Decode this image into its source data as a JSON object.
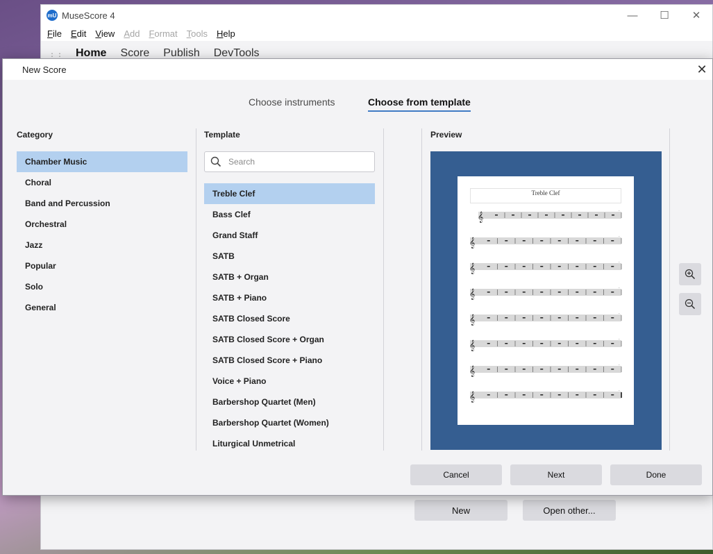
{
  "app": {
    "title": "MuseScore 4",
    "logo_text": "mU",
    "menu": [
      {
        "label": "File",
        "underline": "F",
        "rest": "ile",
        "enabled": true
      },
      {
        "label": "Edit",
        "underline": "E",
        "rest": "dit",
        "enabled": true
      },
      {
        "label": "View",
        "underline": "V",
        "rest": "iew",
        "enabled": true
      },
      {
        "label": "Add",
        "underline": "A",
        "rest": "dd",
        "enabled": false
      },
      {
        "label": "Format",
        "underline": "F",
        "rest": "ormat",
        "enabled": false
      },
      {
        "label": "Tools",
        "underline": "T",
        "rest": "ools",
        "enabled": false
      },
      {
        "label": "Help",
        "underline": "H",
        "rest": "elp",
        "enabled": true
      }
    ],
    "top_tabs": [
      "Home",
      "Score",
      "Publish",
      "DevTools"
    ],
    "home_buttons": {
      "new": "New",
      "open_other": "Open other..."
    }
  },
  "dialog": {
    "title": "New Score",
    "mode_tabs": [
      {
        "label": "Choose instruments",
        "active": false
      },
      {
        "label": "Choose from template",
        "active": true
      }
    ],
    "category_label": "Category",
    "categories": [
      {
        "label": "Chamber Music",
        "selected": true
      },
      {
        "label": "Choral",
        "selected": false
      },
      {
        "label": "Band and Percussion",
        "selected": false
      },
      {
        "label": "Orchestral",
        "selected": false
      },
      {
        "label": "Jazz",
        "selected": false
      },
      {
        "label": "Popular",
        "selected": false
      },
      {
        "label": "Solo",
        "selected": false
      },
      {
        "label": "General",
        "selected": false
      }
    ],
    "template_label": "Template",
    "search_placeholder": "Search",
    "templates": [
      {
        "label": "Treble Clef",
        "selected": true
      },
      {
        "label": "Bass Clef",
        "selected": false
      },
      {
        "label": "Grand Staff",
        "selected": false
      },
      {
        "label": "SATB",
        "selected": false
      },
      {
        "label": "SATB + Organ",
        "selected": false
      },
      {
        "label": "SATB + Piano",
        "selected": false
      },
      {
        "label": "SATB Closed Score",
        "selected": false
      },
      {
        "label": "SATB Closed Score + Organ",
        "selected": false
      },
      {
        "label": "SATB Closed Score + Piano",
        "selected": false
      },
      {
        "label": "Voice + Piano",
        "selected": false
      },
      {
        "label": "Barbershop Quartet (Men)",
        "selected": false
      },
      {
        "label": "Barbershop Quartet (Women)",
        "selected": false
      },
      {
        "label": "Liturgical Unmetrical",
        "selected": false
      }
    ],
    "preview_label": "Preview",
    "preview": {
      "score_title": "Treble Clef",
      "systems": 8
    },
    "buttons": {
      "cancel": "Cancel",
      "next": "Next",
      "done": "Done"
    }
  },
  "colors": {
    "selection": "#b3d0ef",
    "preview_bg": "#355e91",
    "accent": "#3f7bc4"
  }
}
